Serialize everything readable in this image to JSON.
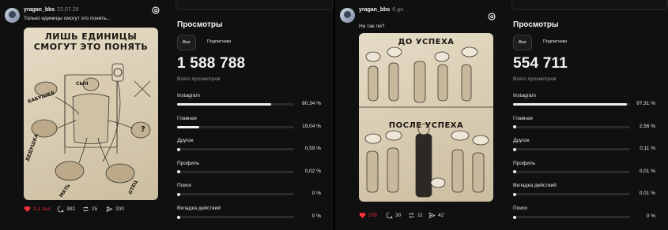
{
  "posts": [
    {
      "username": "yragan_bbs",
      "date": "22.07.26",
      "text": "Только единицы смогут это понять...",
      "image_title_1": "ЛИШЬ ЕДИНИЦЫ",
      "image_title_2": "СМОГУТ ЭТО ПОНЯТЬ",
      "image_labels": {
        "son": "СЫН",
        "grandma": "БАБУШКА",
        "grandpa": "ДЕДУШКА",
        "mother": "МАТЬ",
        "father": "ОТЕЦ",
        "question": "?"
      },
      "likes": "1,1 тыс.",
      "comments": "382",
      "reposts": "25",
      "shares": "200"
    },
    {
      "username": "yragan_bbs",
      "date": "6 дн.",
      "text": "Не так ли?",
      "image_title_1": "ДО УСПЕХА",
      "image_title_2": "ПОСЛЕ УСПЕХА",
      "likes": "278",
      "comments": "30",
      "reposts": "11",
      "shares": "42"
    }
  ],
  "stats": [
    {
      "title": "Просмотры",
      "tab_all": "Все",
      "tab_subs": "Подписчики",
      "total": "1 588 788",
      "total_label": "Всего просмотров",
      "rows": [
        {
          "label": "Instagram",
          "pct": "80,34 %",
          "value": 80.34
        },
        {
          "label": "Главная",
          "pct": "19,04 %",
          "value": 19.04
        },
        {
          "label": "Другое",
          "pct": "0,59 %",
          "value": 0.59
        },
        {
          "label": "Профиль",
          "pct": "0,02 %",
          "value": 0.02
        },
        {
          "label": "Поиск",
          "pct": "0 %",
          "value": 0
        },
        {
          "label": "Вкладка действий",
          "pct": "0 %",
          "value": 0
        }
      ]
    },
    {
      "title": "Просмотры",
      "tab_all": "Все",
      "tab_subs": "Подписчики",
      "total": "554 711",
      "total_label": "Всего просмотров",
      "rows": [
        {
          "label": "Instagram",
          "pct": "97,31 %",
          "value": 97.31
        },
        {
          "label": "Главная",
          "pct": "2,56 %",
          "value": 2.56
        },
        {
          "label": "Другое",
          "pct": "0,11 %",
          "value": 0.11
        },
        {
          "label": "Профиль",
          "pct": "0,01 %",
          "value": 0.01
        },
        {
          "label": "Вкладка действий",
          "pct": "0,01 %",
          "value": 0.01
        },
        {
          "label": "Поиск",
          "pct": "0 %",
          "value": 0
        }
      ]
    }
  ],
  "colors": {
    "like": "#ff3040",
    "bar": "#f0f0f0",
    "track": "#2a2a2a"
  },
  "icons": [
    "avatar",
    "threads-logo-icon",
    "heart-icon",
    "comment-icon",
    "repost-icon",
    "share-icon"
  ]
}
